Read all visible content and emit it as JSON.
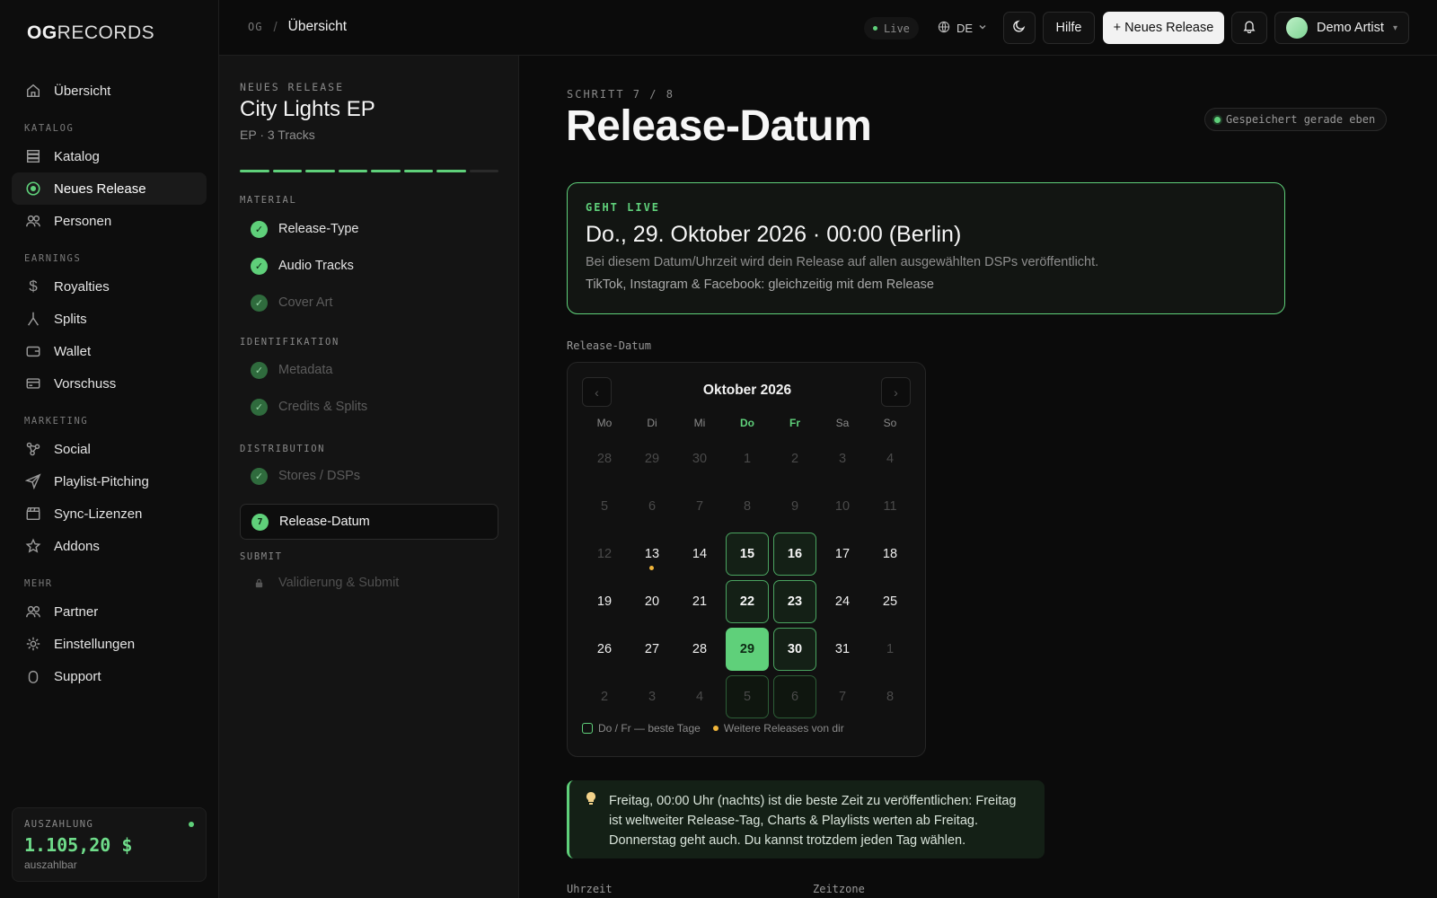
{
  "brand": {
    "logo_bold": "OG",
    "logo_light": "RECORDS"
  },
  "sidebar": {
    "top_item": {
      "label": "Übersicht"
    },
    "sections": [
      {
        "title": "KATALOG",
        "items": [
          {
            "label": "Katalog"
          },
          {
            "label": "Neues Release"
          },
          {
            "label": "Personen"
          }
        ]
      },
      {
        "title": "EARNINGS",
        "items": [
          {
            "label": "Royalties"
          },
          {
            "label": "Splits"
          },
          {
            "label": "Wallet"
          },
          {
            "label": "Vorschuss"
          }
        ]
      },
      {
        "title": "MARKETING",
        "items": [
          {
            "label": "Social"
          },
          {
            "label": "Playlist-Pitching"
          },
          {
            "label": "Sync-Lizenzen"
          },
          {
            "label": "Addons"
          }
        ]
      },
      {
        "title": "MEHR",
        "items": [
          {
            "label": "Partner"
          },
          {
            "label": "Einstellungen"
          },
          {
            "label": "Support"
          }
        ]
      }
    ],
    "active": "Neues Release",
    "payout": {
      "label": "AUSZAHLUNG",
      "amount": "1.105,20 $",
      "sub": "auszahlbar"
    }
  },
  "topbar": {
    "crumb_root": "OG",
    "crumb_sep": "/",
    "crumb_current": "Übersicht",
    "live": "Live",
    "lang": "DE",
    "help": "Hilfe",
    "new_release": "+ Neues Release",
    "user": "Demo Artist"
  },
  "steps_panel": {
    "kicker": "NEUES RELEASE",
    "title": "City Lights EP",
    "subtitle": "EP · 3 Tracks",
    "progress": {
      "done": 7,
      "total": 8
    },
    "groups": {
      "material": "MATERIAL",
      "identifikation": "IDENTIFIKATION",
      "distribution": "DISTRIBUTION",
      "submit": "SUBMIT"
    },
    "steps": {
      "release_type": "Release-Type",
      "audio_tracks": "Audio Tracks",
      "cover_art": "Cover Art",
      "metadata": "Metadata",
      "credits": "Credits & Splits",
      "stores": "Stores / DSPs",
      "release_date": "Release-Datum",
      "release_date_num": "7",
      "submit": "Validierung & Submit"
    }
  },
  "main": {
    "kicker": "SCHRITT 7 / 8",
    "title": "Release-Datum",
    "saved": "Gespeichert gerade eben",
    "golive": {
      "kicker": "GEHT LIVE",
      "datetime": "Do., 29. Oktober 2026 · 00:00 (Berlin)",
      "line1": "Bei diesem Datum/Uhrzeit wird dein Release auf allen ausgewählten DSPs veröffentlicht.",
      "line2": "TikTok, Instagram & Facebook: gleichzeitig mit dem Release"
    },
    "calendar_label": "Release-Datum",
    "calendar": {
      "month": "Oktober 2026",
      "prev": "‹",
      "next": "›",
      "weekdays": [
        "Mo",
        "Di",
        "Mi",
        "Do",
        "Fr",
        "Sa",
        "So"
      ],
      "highlight_weekdays": [
        3,
        4
      ],
      "weeks": [
        [
          28,
          29,
          30,
          1,
          2,
          3,
          4
        ],
        [
          5,
          6,
          7,
          8,
          9,
          10,
          11
        ],
        [
          12,
          13,
          14,
          15,
          16,
          17,
          18
        ],
        [
          19,
          20,
          21,
          22,
          23,
          24,
          25
        ],
        [
          26,
          27,
          28,
          29,
          30,
          31,
          1
        ],
        [
          2,
          3,
          4,
          5,
          6,
          7,
          8
        ]
      ],
      "muted_cells": [
        "0-0",
        "0-1",
        "0-2",
        "0-3",
        "0-4",
        "0-5",
        "0-6",
        "1-0",
        "1-1",
        "1-2",
        "1-3",
        "1-4",
        "1-5",
        "1-6",
        "2-0",
        "4-6",
        "5-0",
        "5-1",
        "5-2",
        "5-3",
        "5-4",
        "5-5",
        "5-6"
      ],
      "best_cells": [
        "2-3",
        "2-4",
        "3-3",
        "3-4",
        "4-3",
        "4-4",
        "5-3",
        "5-4"
      ],
      "selected_cell": "4-3",
      "event_cells": [
        "2-1"
      ],
      "legend_best": "Do / Fr — beste Tage",
      "legend_events": "Weitere Releases von dir"
    },
    "tip": "Freitag, 00:00 Uhr (nachts) ist die beste Zeit zu veröffentlichen: Freitag ist weltweiter Release-Tag, Charts & Playlists werten ab Freitag. Donnerstag geht auch. Du kannst trotzdem jeden Tag wählen.",
    "time_label": "Uhrzeit",
    "tz_label": "Zeitzone"
  },
  "colors": {
    "accent": "#5fd07a",
    "event": "#f0b53a",
    "bg": "#0b0b0b"
  }
}
